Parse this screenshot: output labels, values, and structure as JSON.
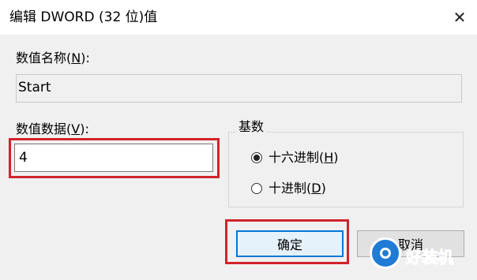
{
  "window": {
    "title": "编辑 DWORD (32 位)值",
    "close_glyph": "✕"
  },
  "value_name": {
    "label_prefix": "数值名称(",
    "label_key": "N",
    "label_suffix": "):",
    "value": "Start"
  },
  "value_data": {
    "label_prefix": "数值数据(",
    "label_key": "V",
    "label_suffix": "):",
    "value": "4"
  },
  "base": {
    "title": "基数",
    "options": [
      {
        "prefix": "十六进制(",
        "key": "H",
        "suffix": ")",
        "selected": true
      },
      {
        "prefix": "十进制(",
        "key": "D",
        "suffix": ")",
        "selected": false
      }
    ]
  },
  "buttons": {
    "ok": "确定",
    "cancel": "取消"
  },
  "watermark": {
    "text": "好装机"
  },
  "colors": {
    "highlight": "#d0242b",
    "accent": "#0078d7"
  }
}
